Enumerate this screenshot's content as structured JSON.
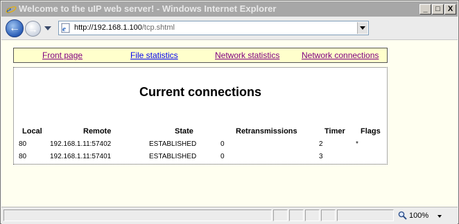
{
  "window": {
    "title": "Welcome to the uIP web server! - Windows Internet Explorer",
    "min_glyph": "_",
    "max_glyph": "□",
    "close_glyph": "X"
  },
  "address": {
    "host": "http://192.168.1.100",
    "path": "/tcp.shtml"
  },
  "menu": [
    {
      "label": "Front page",
      "visited": true
    },
    {
      "label": "File statistics",
      "visited": false
    },
    {
      "label": "Network statistics",
      "visited": true
    },
    {
      "label": "Network connections",
      "visited": true
    }
  ],
  "page": {
    "heading": "Current connections",
    "columns": [
      "Local",
      "Remote",
      "State",
      "Retransmissions",
      "Timer",
      "Flags"
    ],
    "rows": [
      {
        "local": "80",
        "remote": "192.168.1.11:57402",
        "state": "ESTABLISHED",
        "retransmissions": "0",
        "timer": "2",
        "flags": "*"
      },
      {
        "local": "80",
        "remote": "192.168.1.11:57401",
        "state": "ESTABLISHED",
        "retransmissions": "0",
        "timer": "3",
        "flags": ""
      }
    ]
  },
  "status": {
    "zoom": "100%"
  },
  "icons": {
    "browser": "ie-logo-icon",
    "back": "back-arrow-icon",
    "forward": "forward-arrow-icon",
    "page": "page-icon",
    "zoom": "magnifier-icon"
  },
  "colors": {
    "link_visited": "#800080",
    "link_unvisited": "#0000ee",
    "menu_bg": "#ffffcc",
    "page_bg": "#fffff0",
    "titlebar": "#a7a7a7"
  }
}
